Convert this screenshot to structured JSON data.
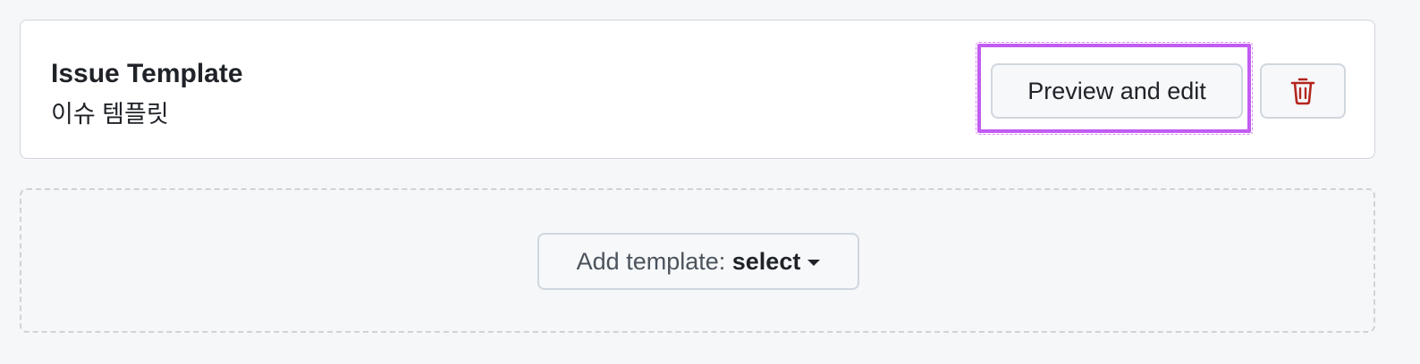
{
  "template": {
    "name": "Issue Template",
    "description": "이슈 템플릿",
    "preview_label": "Preview and edit",
    "delete_icon": "trash-icon"
  },
  "add_template": {
    "label": "Add template: ",
    "value": "select",
    "caret_icon": "triangle-down-icon"
  },
  "colors": {
    "highlight": "#c25cf2",
    "delete_icon": "#b3261e",
    "background": "#f6f7f9"
  }
}
